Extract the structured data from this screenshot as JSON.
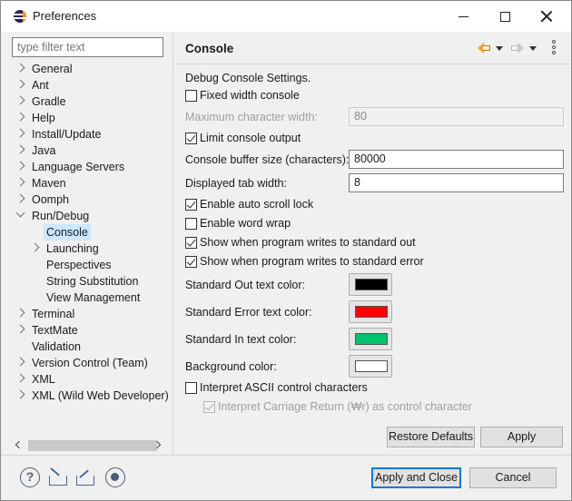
{
  "window": {
    "title": "Preferences",
    "controls": {
      "minimize": "minimize",
      "maximize": "maximize",
      "close": "close"
    }
  },
  "sidebar": {
    "filter_placeholder": "type filter text",
    "tree": [
      {
        "label": "General",
        "expander": "collapsed"
      },
      {
        "label": "Ant",
        "expander": "collapsed"
      },
      {
        "label": "Gradle",
        "expander": "collapsed"
      },
      {
        "label": "Help",
        "expander": "collapsed"
      },
      {
        "label": "Install/Update",
        "expander": "collapsed"
      },
      {
        "label": "Java",
        "expander": "collapsed"
      },
      {
        "label": "Language Servers",
        "expander": "collapsed"
      },
      {
        "label": "Maven",
        "expander": "collapsed"
      },
      {
        "label": "Oomph",
        "expander": "collapsed"
      },
      {
        "label": "Run/Debug",
        "expander": "expanded"
      },
      {
        "label": "Console",
        "selected": true
      },
      {
        "label": "Launching",
        "expander": "collapsed"
      },
      {
        "label": "Perspectives"
      },
      {
        "label": "String Substitution"
      },
      {
        "label": "View Management"
      },
      {
        "label": "Terminal",
        "expander": "collapsed"
      },
      {
        "label": "TextMate",
        "expander": "collapsed"
      },
      {
        "label": "Validation"
      },
      {
        "label": "Version Control (Team)",
        "expander": "collapsed"
      },
      {
        "label": "XML",
        "expander": "collapsed"
      },
      {
        "label": "XML (Wild Web Developer)",
        "expander": "collapsed"
      }
    ]
  },
  "page": {
    "title": "Console",
    "icons": {
      "back": "back-arrow-icon",
      "forward": "forward-arrow-icon",
      "menu": "view-menu-icon"
    },
    "section_label": "Debug Console Settings.",
    "fixed_width": {
      "label": "Fixed width console",
      "checked": false
    },
    "max_char_width": {
      "label": "Maximum character width:",
      "value": "80",
      "enabled": false
    },
    "limit_output": {
      "label": "Limit console output",
      "checked": true
    },
    "buffer_size": {
      "label": "Console buffer size (characters):",
      "value": "80000"
    },
    "tab_width": {
      "label": "Displayed tab width:",
      "value": "8"
    },
    "auto_scroll": {
      "label": "Enable auto scroll lock",
      "checked": true
    },
    "word_wrap": {
      "label": "Enable word wrap",
      "checked": false
    },
    "show_out": {
      "label": "Show when program writes to standard out",
      "checked": true
    },
    "show_err": {
      "label": "Show when program writes to standard error",
      "checked": true
    },
    "colors": {
      "std_out": {
        "label": "Standard Out text color:",
        "color": "#000000"
      },
      "std_err": {
        "label": "Standard Error text color:",
        "color": "#ff0000"
      },
      "std_in": {
        "label": "Standard In text color:",
        "color": "#00c36e"
      },
      "background": {
        "label": "Background color:",
        "color": "#ffffff"
      }
    },
    "ascii": {
      "label": "Interpret ASCII control characters",
      "checked": false
    },
    "carriage": {
      "label": "Interpret Carriage Return (₩r) as control character",
      "checked": true,
      "enabled": false
    },
    "restore_defaults": "Restore Defaults",
    "apply": "Apply"
  },
  "footer": {
    "icons": [
      "help-icon",
      "import-icon",
      "export-icon",
      "record-icon"
    ],
    "help_glyph": "?",
    "apply_close": "Apply and Close",
    "cancel": "Cancel"
  }
}
